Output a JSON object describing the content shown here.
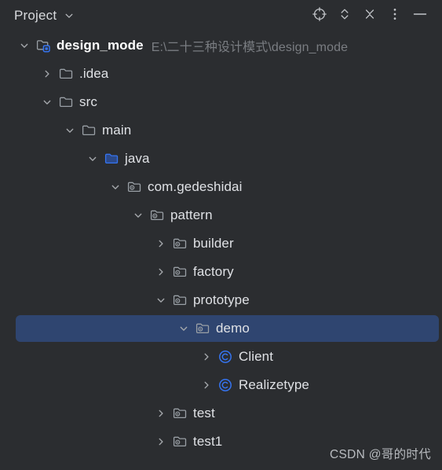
{
  "header": {
    "title": "Project",
    "dropdown_icon": "chevron-down-icon",
    "buttons": [
      {
        "name": "select-opened-file-button",
        "icon": "crosshair-target-icon",
        "tooltip": "Select Opened File"
      },
      {
        "name": "expand-collapse-button",
        "icon": "chevron-up-down-icon",
        "tooltip": "Expand / Collapse"
      },
      {
        "name": "collapse-all-button",
        "icon": "collapse-all-icon",
        "tooltip": "Collapse All"
      },
      {
        "name": "options-button",
        "icon": "more-vertical-dots-icon",
        "tooltip": "Options"
      },
      {
        "name": "hide-button",
        "icon": "minimize-dash-icon",
        "tooltip": "Hide"
      }
    ]
  },
  "colors": {
    "background": "#2b2d30",
    "selection": "#2f4570",
    "text": "#dfe1e5",
    "path_text": "#7a7d82",
    "accent_blue": "#3574f0",
    "folder_gray": "#9aa0a6",
    "watermark": "#b9bcc0"
  },
  "tree": {
    "nodes": [
      {
        "label": "design_mode",
        "secondary": "E:\\二十三种设计模式\\design_mode",
        "depth": 0,
        "icon": "project-folder-icon",
        "state": "expanded",
        "twisty": "chevron-down-icon",
        "selected": false,
        "bold": true
      },
      {
        "label": ".idea",
        "secondary": "",
        "depth": 1,
        "icon": "folder-icon",
        "state": "collapsed",
        "twisty": "chevron-right-icon",
        "selected": false,
        "bold": false
      },
      {
        "label": "src",
        "secondary": "",
        "depth": 1,
        "icon": "folder-icon",
        "state": "expanded",
        "twisty": "chevron-down-icon",
        "selected": false,
        "bold": false
      },
      {
        "label": "main",
        "secondary": "",
        "depth": 2,
        "icon": "folder-icon",
        "state": "expanded",
        "twisty": "chevron-down-icon",
        "selected": false,
        "bold": false
      },
      {
        "label": "java",
        "secondary": "",
        "depth": 3,
        "icon": "source-root-folder-icon",
        "state": "expanded",
        "twisty": "chevron-down-icon",
        "selected": false,
        "bold": false
      },
      {
        "label": "com.gedeshidai",
        "secondary": "",
        "depth": 4,
        "icon": "package-folder-icon",
        "state": "expanded",
        "twisty": "chevron-down-icon",
        "selected": false,
        "bold": false
      },
      {
        "label": "pattern",
        "secondary": "",
        "depth": 5,
        "icon": "package-folder-icon",
        "state": "expanded",
        "twisty": "chevron-down-icon",
        "selected": false,
        "bold": false
      },
      {
        "label": "builder",
        "secondary": "",
        "depth": 6,
        "icon": "package-folder-icon",
        "state": "collapsed",
        "twisty": "chevron-right-icon",
        "selected": false,
        "bold": false
      },
      {
        "label": "factory",
        "secondary": "",
        "depth": 6,
        "icon": "package-folder-icon",
        "state": "collapsed",
        "twisty": "chevron-right-icon",
        "selected": false,
        "bold": false
      },
      {
        "label": "prototype",
        "secondary": "",
        "depth": 6,
        "icon": "package-folder-icon",
        "state": "expanded",
        "twisty": "chevron-down-icon",
        "selected": false,
        "bold": false
      },
      {
        "label": "demo",
        "secondary": "",
        "depth": 7,
        "icon": "package-folder-icon",
        "state": "expanded",
        "twisty": "chevron-down-icon",
        "selected": true,
        "bold": false
      },
      {
        "label": "Client",
        "secondary": "",
        "depth": 8,
        "icon": "java-class-icon",
        "state": "collapsed",
        "twisty": "chevron-right-icon",
        "selected": false,
        "bold": false
      },
      {
        "label": "Realizetype",
        "secondary": "",
        "depth": 8,
        "icon": "java-class-icon",
        "state": "collapsed",
        "twisty": "chevron-right-icon",
        "selected": false,
        "bold": false
      },
      {
        "label": "test",
        "secondary": "",
        "depth": 6,
        "icon": "package-folder-icon",
        "state": "collapsed",
        "twisty": "chevron-right-icon",
        "selected": false,
        "bold": false
      },
      {
        "label": "test1",
        "secondary": "",
        "depth": 6,
        "icon": "package-folder-icon",
        "state": "collapsed",
        "twisty": "chevron-right-icon",
        "selected": false,
        "bold": false
      }
    ]
  },
  "watermark": {
    "text": "CSDN @哥的时代"
  }
}
